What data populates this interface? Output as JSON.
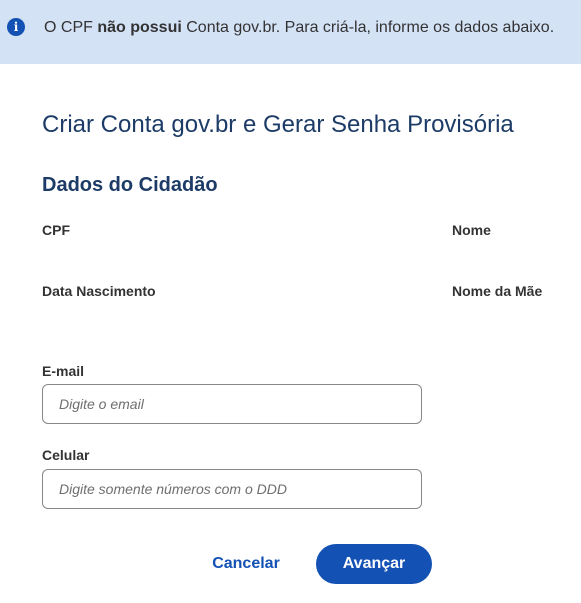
{
  "alert": {
    "icon": "info-icon",
    "icon_glyph": "i",
    "text_before": "O CPF ",
    "text_bold": "não possui",
    "text_after": " Conta gov.br. Para criá-la, informe os dados abaixo."
  },
  "page_title": "Criar Conta gov.br e Gerar Senha Provisória",
  "section_title": "Dados do Cidadão",
  "fields": {
    "cpf_label": "CPF",
    "nome_label": "Nome",
    "data_nascimento_label": "Data Nascimento",
    "nome_mae_label": "Nome da Mãe",
    "email_label": "E-mail",
    "email_placeholder": "Digite o email",
    "email_value": "",
    "celular_label": "Celular",
    "celular_placeholder": "Digite somente números com o DDD",
    "celular_value": ""
  },
  "buttons": {
    "cancel": "Cancelar",
    "next": "Avançar"
  },
  "colors": {
    "alert_bg": "#d4e2f6",
    "primary": "#1351b4",
    "title": "#1c3b66"
  }
}
